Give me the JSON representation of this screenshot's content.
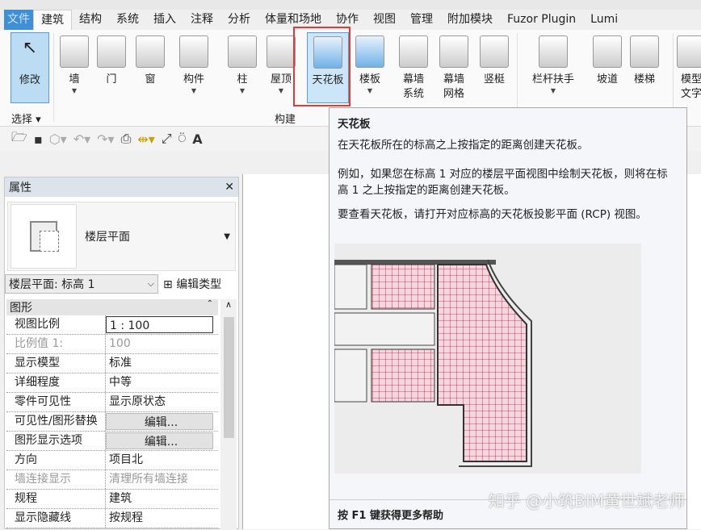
{
  "ribbon_tabs": [
    "文件",
    "建筑",
    "结构",
    "系统",
    "插入",
    "注释",
    "分析",
    "体量和场地",
    "协作",
    "视图",
    "管理",
    "附加模块",
    "Fuzor Plugin",
    "Lumi"
  ],
  "ribbon": {
    "modify": "修改",
    "tools": [
      {
        "label": "墙",
        "drop": true
      },
      {
        "label": "门",
        "drop": false
      },
      {
        "label": "窗",
        "drop": false
      },
      {
        "label": "构件",
        "drop": true
      },
      {
        "label": "柱",
        "drop": true
      },
      {
        "label": "屋顶",
        "drop": true
      },
      {
        "label": "天花板",
        "drop": false
      },
      {
        "label": "楼板",
        "drop": true
      },
      {
        "label": "幕墙\n系统",
        "drop": false
      },
      {
        "label": "幕墙\n网格",
        "drop": false
      },
      {
        "label": "竖梃",
        "drop": false
      },
      {
        "label": "栏杆扶手",
        "drop": true
      },
      {
        "label": "坡道",
        "drop": false
      },
      {
        "label": "楼梯",
        "drop": false
      },
      {
        "label": "模型\n文字",
        "drop": false
      }
    ],
    "panel_select": "选择 ▾",
    "panel_build": "构建"
  },
  "tooltip": {
    "title": "天花板",
    "desc": "在天花板所在的标高之上按指定的距离创建天花板。",
    "example": "例如，如果您在标高 1 对应的楼层平面视图中绘制天花板，则将在标高 1 之上按指定的距离创建天花板。",
    "rcp": "要查看天花板，请打开对应标高的天花板投影平面 (RCP) 视图。",
    "footer": "按 F1 键获得更多帮助"
  },
  "properties": {
    "title": "属性",
    "type_name": "楼层平面",
    "selector": "楼层平面: 标高 1",
    "edit_type": "编辑类型",
    "group": "图形",
    "rows": [
      {
        "k": "视图比例",
        "v": "1 : 100",
        "style": "input"
      },
      {
        "k": "比例值 1:",
        "v": "100",
        "style": "grey"
      },
      {
        "k": "显示模型",
        "v": "标准"
      },
      {
        "k": "详细程度",
        "v": "中等"
      },
      {
        "k": "零件可见性",
        "v": "显示原状态"
      },
      {
        "k": "可见性/图形替换",
        "v": "编辑...",
        "style": "button"
      },
      {
        "k": "图形显示选项",
        "v": "编辑...",
        "style": "button"
      },
      {
        "k": "方向",
        "v": "项目北"
      },
      {
        "k": "墙连接显示",
        "v": "清理所有墙连接",
        "style": "grey"
      },
      {
        "k": "规程",
        "v": "建筑"
      },
      {
        "k": "显示隐藏线",
        "v": "按规程"
      }
    ]
  },
  "watermark": "知乎 @小筑BIM黄世斌老师",
  "colors": {
    "accent": "#3f8fd6",
    "highlight": "#e53935",
    "ceiling_grid": "#d0114a"
  }
}
